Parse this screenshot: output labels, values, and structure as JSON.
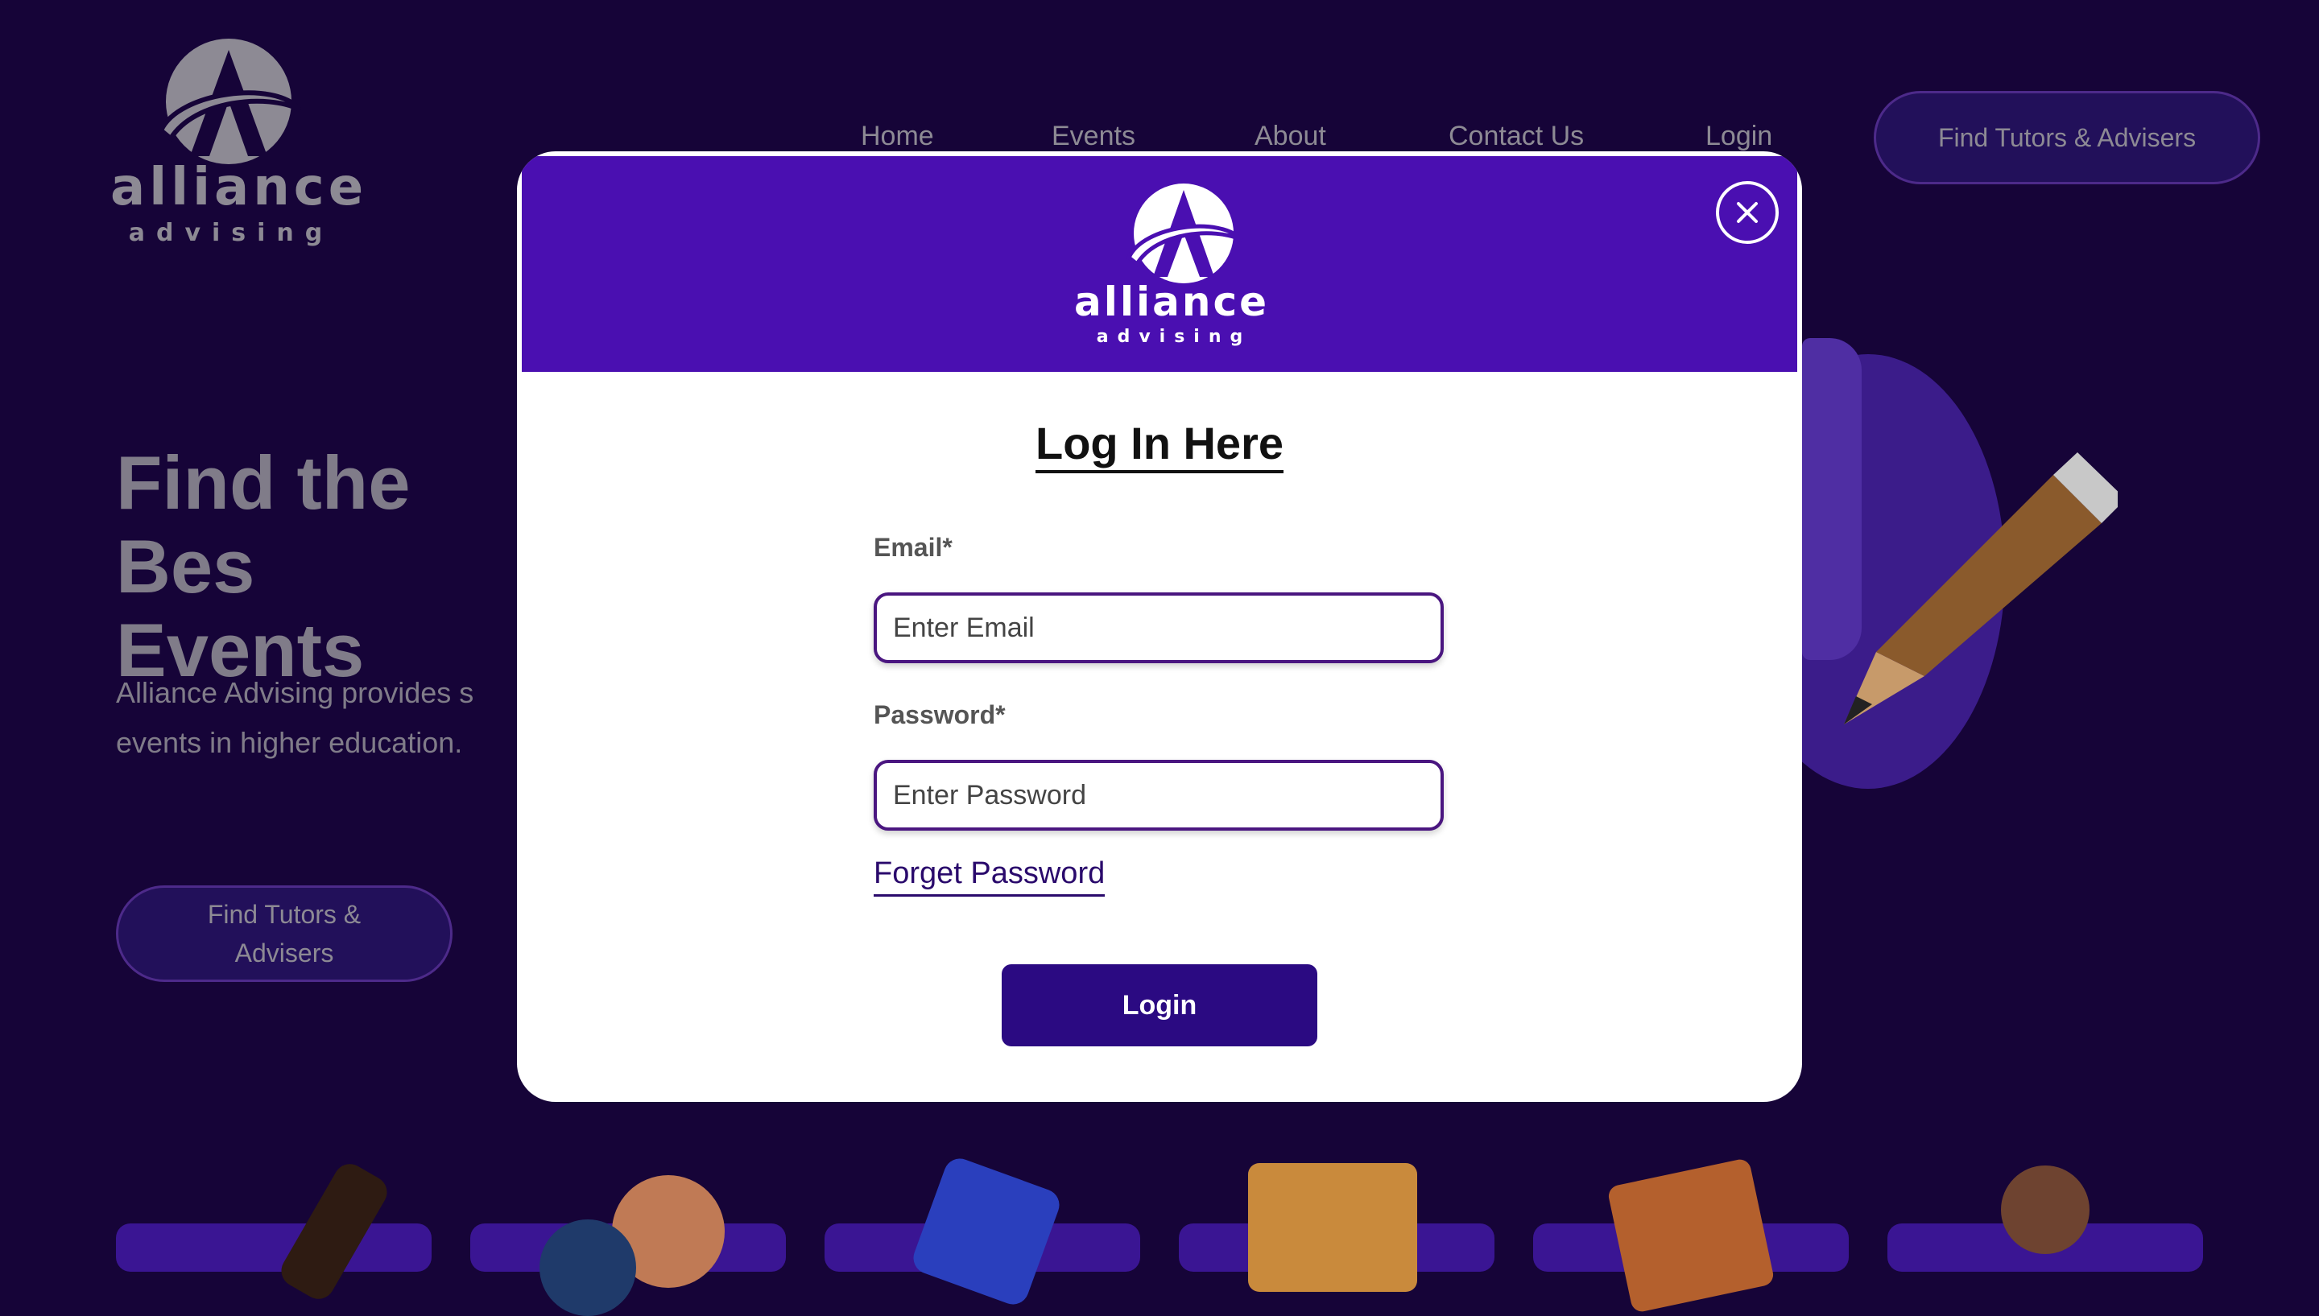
{
  "brand": {
    "name": "alliance",
    "tagline": "advising"
  },
  "nav": {
    "items": [
      "Home",
      "Events",
      "About",
      "Contact Us",
      "Login"
    ],
    "cta_label": "Find Tutors & Advisers"
  },
  "hero": {
    "title": "Find the Bes\nEvents",
    "description": "Alliance Advising provides s\nevents in higher education.",
    "cta_label": "Find Tutors & Advisers"
  },
  "modal": {
    "title": "Log In Here",
    "email_label": "Email*",
    "email_placeholder": "Enter Email",
    "password_label": "Password*",
    "password_placeholder": "Enter Password",
    "forgot_label": "Forget Password",
    "submit_label": "Login",
    "close_icon": "close-icon"
  },
  "colors": {
    "page_bg": "#160438",
    "modal_header": "#4a0fb1",
    "button": "#2b0a82",
    "input_border": "#4a1680"
  }
}
